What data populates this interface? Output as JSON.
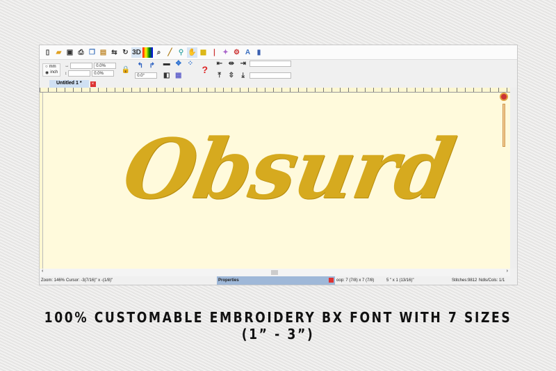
{
  "toolbar": {
    "icons": [
      "new-icon",
      "open-icon",
      "save-icon",
      "print-icon",
      "copy-icon",
      "paste-icon",
      "mirror-icon",
      "rotate-icon",
      "3d-icon",
      "color-icon",
      "zoom-icon",
      "measure-icon",
      "stitch-icon",
      "hand-icon",
      "image-icon",
      "thread-icon",
      "pattern-icon",
      "settings-icon",
      "text-icon",
      "export-icon"
    ],
    "label_3d": "3D",
    "label_text": "A"
  },
  "units": {
    "mm": "mm",
    "inch": "inch",
    "selected": "inch"
  },
  "size": {
    "width_value": "",
    "height_value": "",
    "width_pct": "0.0%",
    "height_pct": "0.0%",
    "angle": "0.0°"
  },
  "tab": {
    "label": "Untitled 1 *"
  },
  "design": {
    "text": "Obsurd",
    "color": "#d6aa1f"
  },
  "status": {
    "zoom": "Zoom: 146%",
    "cursor": "Cursor: -3(7/16)\" x -(1/8)\"",
    "properties": "Properties",
    "hoop": "oop: 7 (7/8) x 7 (7/8)",
    "size": "5 \" x 1 (13/16)\"",
    "stitches": "Stitches:9812",
    "ndls": "Ndls/Cols: 1/1"
  },
  "caption": "100% CUSTOMABLE EMBROIDERY BX FONT WITH 7 SIZES (1” -  3”)"
}
